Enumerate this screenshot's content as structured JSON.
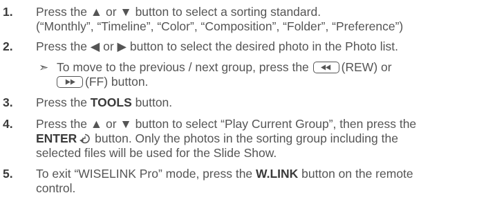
{
  "steps": [
    {
      "number": "1.",
      "line1": "Press the ▲ or ▼ button to select a sorting standard.",
      "line2": "(“Monthly”, “Timeline”, “Color”, “Composition”, “Folder”, “Preference”)"
    },
    {
      "number": "2.",
      "line1": "Press the ◀ or ▶ button to select the desired photo in the Photo list.",
      "note": {
        "marker": "➣",
        "part1": "To move to the previous / next group, press the",
        "rew_label": "(REW) or",
        "ff_label": "(FF) button."
      }
    },
    {
      "number": "3.",
      "pre": "Press the ",
      "bold": "TOOLS",
      "post": " button."
    },
    {
      "number": "4.",
      "line1": "Press the ▲ or ▼ button to select “Play Current Group”, then press the",
      "bold": "ENTER",
      "line2_post": " button. Only the photos in the sorting group including the",
      "line3": "selected files will be used for the Slide Show."
    },
    {
      "number": "5.",
      "pre": "To exit “WISELINK Pro” mode, press the ",
      "bold": "W.LINK",
      "post": " button on the remote",
      "line2": "control."
    }
  ],
  "icons": {
    "rew": "rewind-icon",
    "ff": "fast-forward-icon",
    "enter": "enter-icon"
  },
  "colors": {
    "text": "#555555",
    "number": "#3a3a3a"
  }
}
